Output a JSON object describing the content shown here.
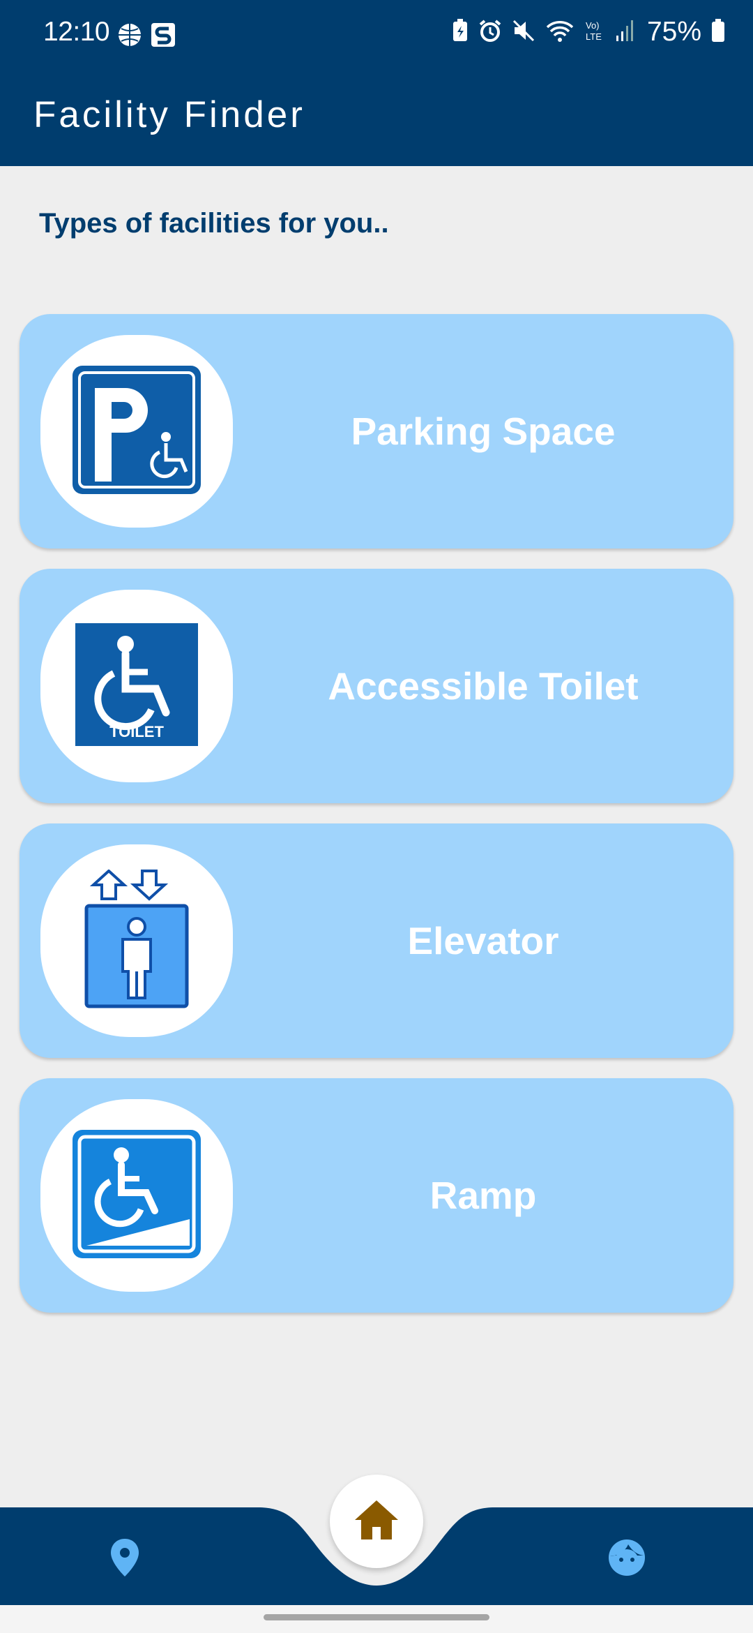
{
  "status_bar": {
    "time": "12:10",
    "battery_percent": "75%"
  },
  "app_bar": {
    "title": "Facility Finder"
  },
  "main": {
    "section_title": "Types of facilities for you..",
    "facilities": [
      {
        "label": "Parking Space",
        "icon": "accessible-parking-icon",
        "icon_text": ""
      },
      {
        "label": "Accessible Toilet",
        "icon": "accessible-toilet-icon",
        "icon_text": "TOILET"
      },
      {
        "label": "Elevator",
        "icon": "elevator-icon",
        "icon_text": ""
      },
      {
        "label": "Ramp",
        "icon": "ramp-icon",
        "icon_text": ""
      }
    ]
  },
  "bottom_nav": {
    "items": [
      {
        "name": "map",
        "icon": "location-pin-icon"
      },
      {
        "name": "home",
        "icon": "home-icon"
      },
      {
        "name": "profile",
        "icon": "face-icon"
      }
    ]
  },
  "colors": {
    "primary": "#003d6e",
    "card_bg": "#a0d4fc",
    "background": "#eeeeee",
    "home_icon": "#8a5a00",
    "nav_icon": "#5fb4f5"
  }
}
